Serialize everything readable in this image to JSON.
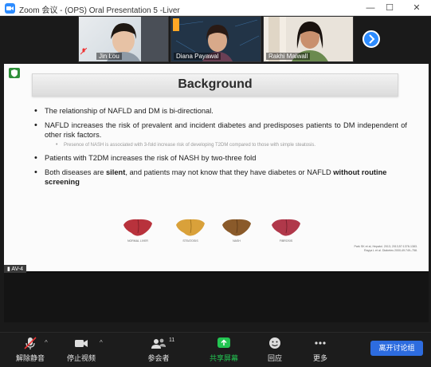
{
  "window": {
    "title": "Zoom 会议 - (OPS) Oral Presentation 5 -Liver",
    "icon": "zoom-app-icon"
  },
  "participants": [
    {
      "name": "Jin Lou",
      "mic": "muted"
    },
    {
      "name": "Diana Payawal",
      "mic": "on"
    },
    {
      "name": "Rakhi Maiwall",
      "mic": "on"
    }
  ],
  "slide": {
    "title": "Background",
    "bullets": [
      {
        "text": "The relationship of NAFLD and DM is bi-directional."
      },
      {
        "text": "NAFLD increases the risk of prevalent and incident diabetes and predisposes patients to DM independent of other risk factors.",
        "sub": "Presence of NASH is associated with 3-fold increase risk of developing T2DM compared to those with simple steatosis."
      },
      {
        "text": "Patients with T2DM increases the risk of NASH by two-three fold"
      },
      {
        "text_a": "Both diseases are ",
        "bold_a": "silent",
        "text_b": ", and patients may not know that they have diabetes or NAFLD ",
        "bold_b": "without routine screening"
      }
    ],
    "livers": [
      {
        "label": "NORMAL LIVER",
        "color": "#b8323c"
      },
      {
        "label": "STEATOSIS",
        "color": "#d9a13a"
      },
      {
        "label": "NASH",
        "color": "#8a5a2a"
      },
      {
        "label": "FIBROSIS",
        "color": "#b0384a"
      }
    ],
    "refs": [
      "Park SK et al, Hepatol. 2013; 2013;57:1378-1383.",
      "Rayya L et al. Diabetes 2000;49:749–758."
    ]
  },
  "share_label": "AV-4",
  "toolbar": {
    "unmute": "解除静音",
    "stop_video": "停止视频",
    "participants": "参会者",
    "participants_count": "11",
    "share": "共享屏幕",
    "reactions": "回应",
    "more": "更多",
    "leave": "离开讨论组"
  },
  "colors": {
    "accent": "#2d8cff",
    "share_green": "#23c552",
    "leave_blue": "#2d6cdf"
  }
}
